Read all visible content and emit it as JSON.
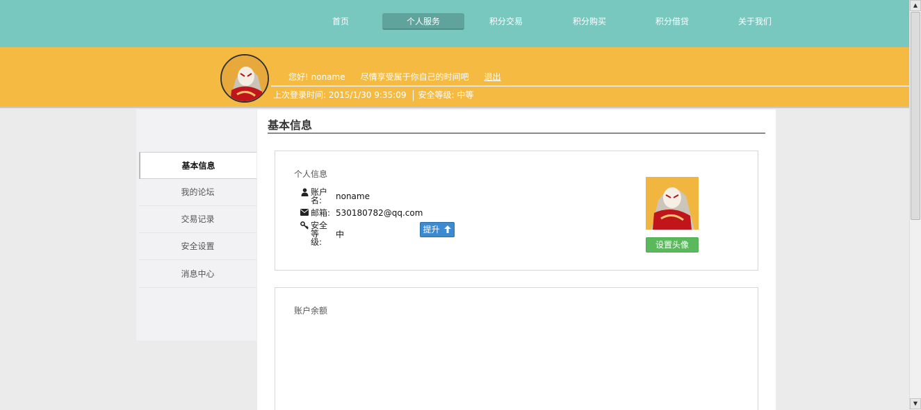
{
  "nav": {
    "items": [
      {
        "label": "首页"
      },
      {
        "label": "个人服务"
      },
      {
        "label": "积分交易"
      },
      {
        "label": "积分购买"
      },
      {
        "label": "积分借贷"
      },
      {
        "label": "关于我们"
      }
    ],
    "active_index": 1
  },
  "userbar": {
    "greeting": "您好! noname",
    "slogan": "尽情享受属于你自己的时间吧",
    "logout": "退出",
    "last_login": "上次登录时间: 2015/1/30 9:35:09",
    "security_level": "安全等级: 中等"
  },
  "sidebar": {
    "items": [
      {
        "label": "基本信息"
      },
      {
        "label": "我的论坛"
      },
      {
        "label": "交易记录"
      },
      {
        "label": "安全设置"
      },
      {
        "label": "消息中心"
      }
    ],
    "active_index": 0
  },
  "main": {
    "title": "基本信息",
    "personal": {
      "title": "个人信息",
      "account_label": "账户名:",
      "account_value": "noname",
      "email_label": "邮箱:",
      "email_value": "530180782@qq.com",
      "security_label": "安全等级:",
      "security_value": "中",
      "upgrade_button": "提升",
      "set_avatar_button": "设置头像"
    },
    "balance": {
      "title": "账户余额"
    }
  },
  "colors": {
    "nav_bg": "#78c8c0",
    "userbar_bg": "#f5ba42",
    "upgrade_btn": "#3c8ad0",
    "set_avatar_btn": "#5cb85c"
  },
  "icons": [
    "user-icon",
    "envelope-icon",
    "key-icon",
    "arrow-up-icon"
  ]
}
